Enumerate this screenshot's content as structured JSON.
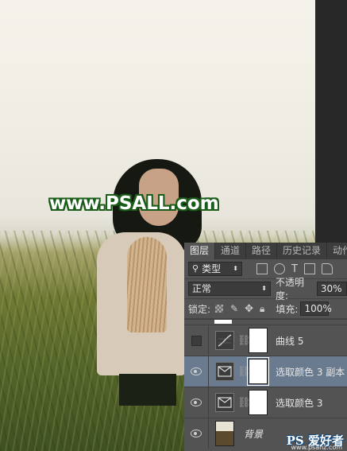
{
  "canvas": {
    "watermark": "www.PSALL.com"
  },
  "panel": {
    "tabs": [
      {
        "label": "图层",
        "active": true
      },
      {
        "label": "通道",
        "active": false
      },
      {
        "label": "路径",
        "active": false
      },
      {
        "label": "历史记录",
        "active": false
      },
      {
        "label": "动作",
        "active": false
      }
    ],
    "filter": {
      "label": "类型",
      "icon": "search-icon"
    },
    "blend_mode": "正常",
    "opacity_label": "不透明度:",
    "opacity_value": "30%",
    "lock_label": "锁定:",
    "fill_label": "填充:",
    "fill_value": "100%",
    "layers": [
      {
        "name": "曲线 5",
        "visible": false,
        "type": "curves",
        "selected": false
      },
      {
        "name": "选取颜色 3 副本",
        "visible": true,
        "type": "selective-color",
        "selected": true
      },
      {
        "name": "选取颜色 3",
        "visible": true,
        "type": "selective-color",
        "selected": false
      },
      {
        "name": "背景",
        "visible": true,
        "type": "photo",
        "selected": false
      }
    ]
  },
  "branding": {
    "logo_text": "PS 爱好者",
    "url": "www.psahz.com"
  },
  "colors": {
    "panel_bg": "#535353",
    "selected_layer": "#6a7b8f",
    "watermark_outline": "#1a5d19"
  }
}
